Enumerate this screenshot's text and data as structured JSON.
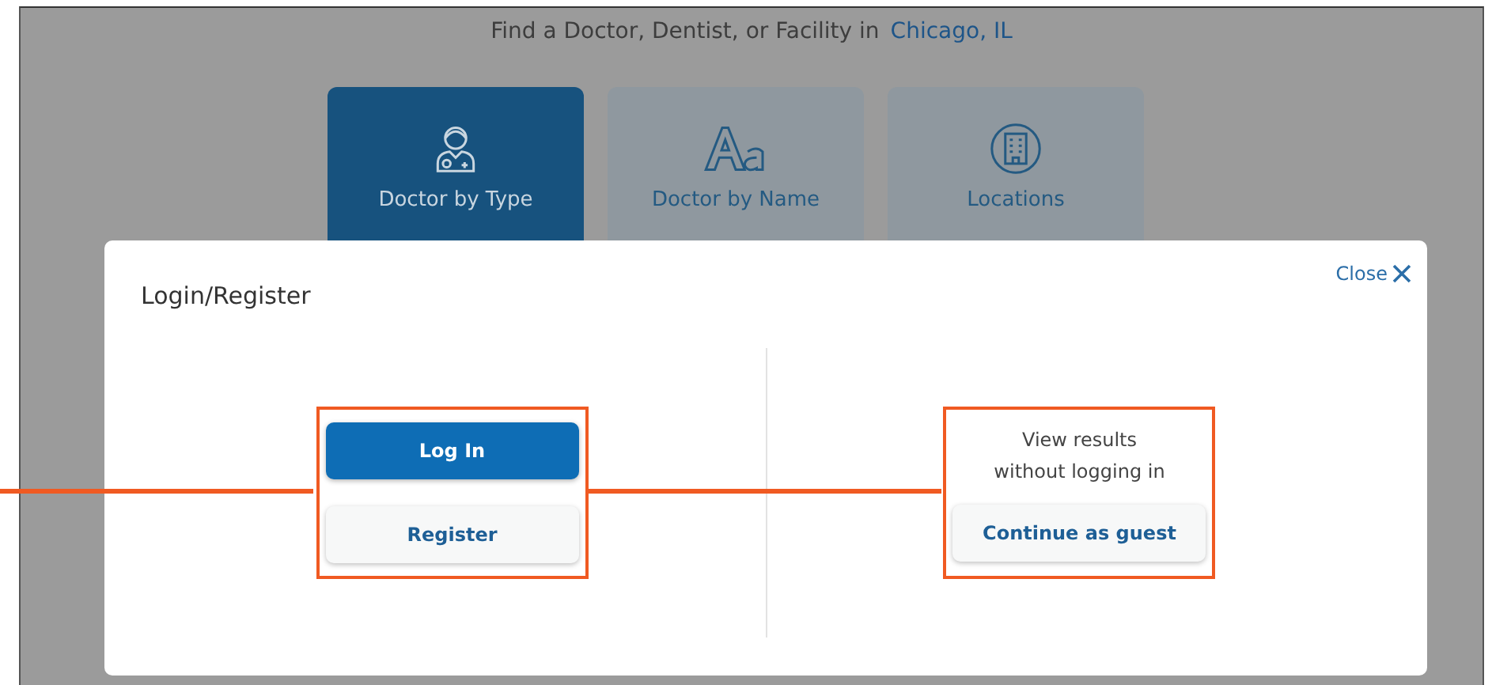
{
  "header": {
    "text": "Find a Doctor, Dentist, or Facility in",
    "location": "Chicago, IL"
  },
  "tabs": [
    {
      "label": "Doctor by Type",
      "kind": "doctor",
      "selected": true
    },
    {
      "label": "Doctor by Name",
      "kind": "name",
      "selected": false
    },
    {
      "label": "Locations",
      "kind": "building",
      "selected": false
    }
  ],
  "dialog": {
    "title": "Login/Register",
    "close": "Close",
    "login": "Log In",
    "register": "Register",
    "guest_text": [
      "View results",
      "without logging in"
    ],
    "guest": "Continue as guest"
  }
}
